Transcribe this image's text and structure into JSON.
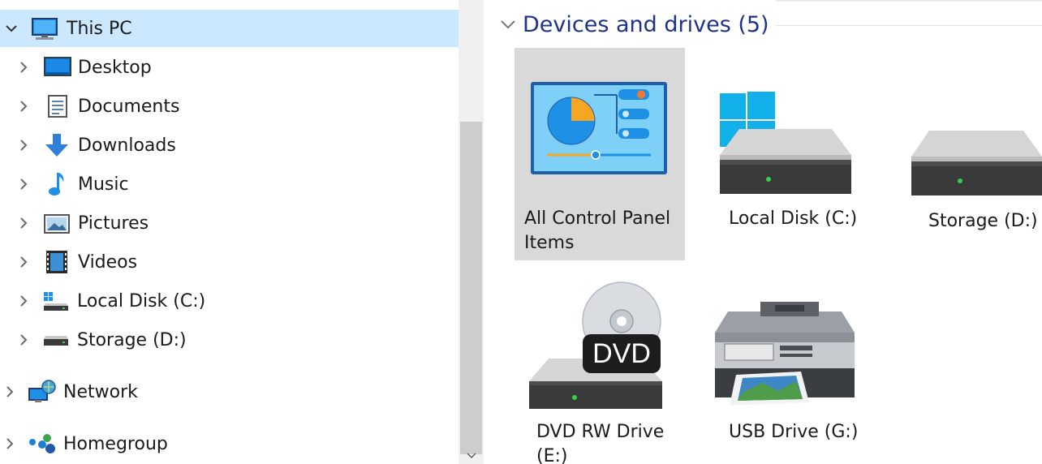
{
  "nav": {
    "items": [
      {
        "label": "This PC",
        "icon": "computer-icon",
        "selected": true
      },
      {
        "label": "Desktop",
        "icon": "desktop-icon"
      },
      {
        "label": "Documents",
        "icon": "documents-icon"
      },
      {
        "label": "Downloads",
        "icon": "downloads-icon"
      },
      {
        "label": "Music",
        "icon": "music-icon"
      },
      {
        "label": "Pictures",
        "icon": "pictures-icon"
      },
      {
        "label": "Videos",
        "icon": "videos-icon"
      },
      {
        "label": "Local Disk (C:)",
        "icon": "local-disk-icon"
      },
      {
        "label": "Storage (D:)",
        "icon": "storage-drive-icon"
      },
      {
        "label": "Network",
        "icon": "network-icon"
      },
      {
        "label": "Homegroup",
        "icon": "homegroup-icon"
      }
    ]
  },
  "content": {
    "group_title": "Devices and drives (5)",
    "tiles": [
      {
        "label": "All Control Panel Items",
        "icon": "control-panel-icon",
        "selected": true
      },
      {
        "label": "Local Disk (C:)",
        "icon": "windows-drive-icon"
      },
      {
        "label": "Storage (D:)",
        "icon": "hard-drive-icon"
      },
      {
        "label": "DVD RW Drive (E:)",
        "icon": "dvd-drive-icon",
        "badge": "DVD"
      },
      {
        "label": "USB Drive (G:)",
        "icon": "printer-icon"
      }
    ]
  },
  "colors": {
    "selection": "#cce8ff",
    "tile_selection": "#d9d9d9",
    "header_text": "#1e3287",
    "accent_blue": "#1e90e6"
  }
}
